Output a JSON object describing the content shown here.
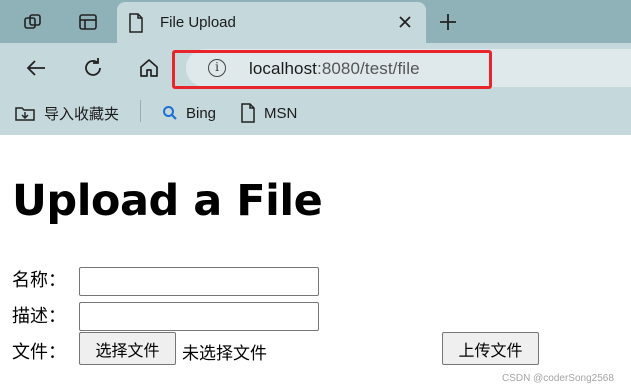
{
  "browser": {
    "tab": {
      "title": "File Upload"
    },
    "address_bar": {
      "host": "localhost",
      "rest": ":8080/test/file"
    },
    "favorites": [
      {
        "label": "导入收藏夹",
        "icon": "import-favorites-icon"
      },
      {
        "label": "Bing",
        "icon": "search-icon"
      },
      {
        "label": "MSN",
        "icon": "page-icon"
      }
    ],
    "colors": {
      "chrome": "#c5d8dc",
      "tabstrip": "#8fb2b8",
      "highlight": "#e8252a"
    }
  },
  "page": {
    "heading": "Upload a File",
    "form": {
      "name_label": "名称：",
      "name_value": "",
      "desc_label": "描述：",
      "desc_value": "",
      "file_label": "文件：",
      "choose_button": "选择文件",
      "no_file_text": "未选择文件",
      "submit_button": "上传文件"
    }
  },
  "watermark": "CSDN @coderSong2568"
}
